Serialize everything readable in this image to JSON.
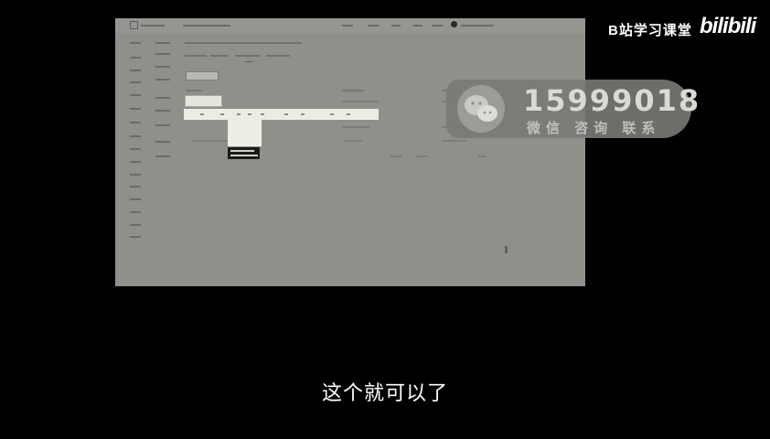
{
  "watermark": {
    "channel": "B站学习课堂",
    "logo": "bilibili"
  },
  "contact_badge": {
    "number": "15999018",
    "caption": "微信 咨询 联系",
    "icon": "wechat-icon"
  },
  "subtitle": "这个就可以了",
  "colors": {
    "frame_bg": "#8f908a",
    "page_bg": "#000000",
    "badge_bg": "#787a74"
  }
}
